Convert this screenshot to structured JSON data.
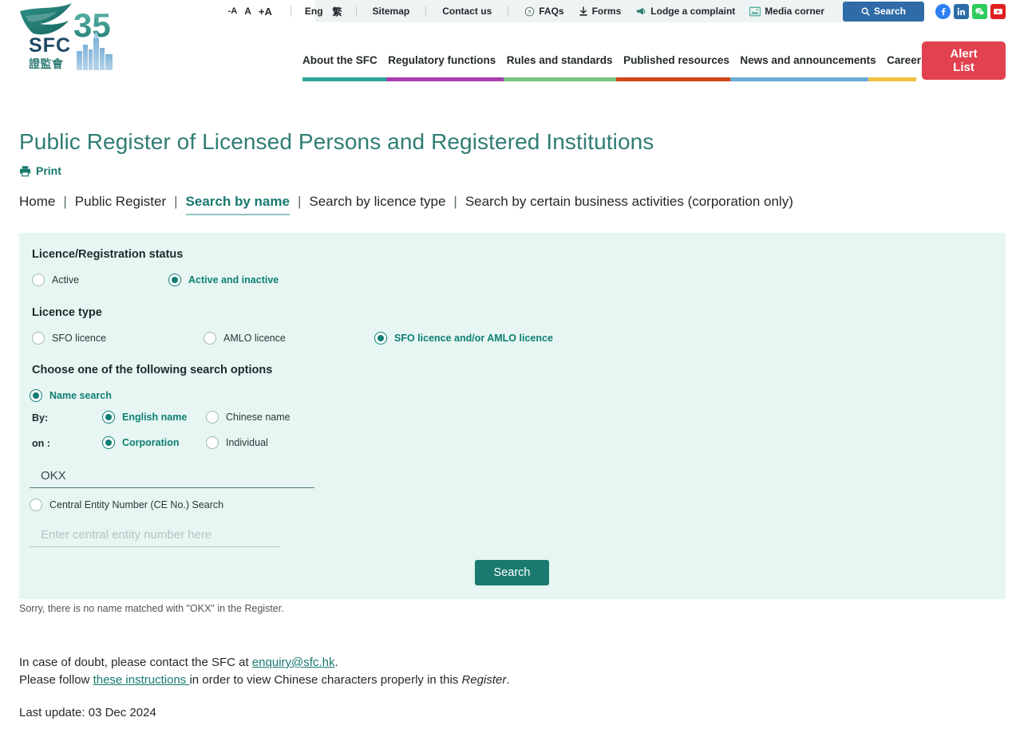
{
  "topbar": {
    "font_size": {
      "decrease": "-A",
      "normal": "A",
      "increase": "+A"
    },
    "lang_en": "Eng",
    "lang_zh": "繁",
    "sitemap": "Sitemap",
    "contact": "Contact us",
    "faqs": "FAQs",
    "forms": "Forms",
    "complaint": "Lodge a complaint",
    "media": "Media corner",
    "search_button": "Search",
    "socials": [
      {
        "name": "facebook-icon",
        "color": "#2d7ff2",
        "glyph": "f"
      },
      {
        "name": "linkedin-icon",
        "color": "#2f6ca7",
        "glyph": "in"
      },
      {
        "name": "wechat-icon",
        "color": "#2ecc5e",
        "glyph": "●"
      },
      {
        "name": "youtube-icon",
        "color": "#e02020",
        "glyph": "▶"
      }
    ]
  },
  "logo": {
    "acronym": "SFC",
    "chinese": "證監會",
    "anniversary": "35",
    "alt": "sfc-35-logo"
  },
  "nav": {
    "items": [
      {
        "label": "About the SFC",
        "color": "#2aa69a"
      },
      {
        "label": "Regulatory functions",
        "color": "#a93fae"
      },
      {
        "label": "Rules and standards",
        "color": "#7cc47f"
      },
      {
        "label": "Published resources",
        "color": "#cf4715"
      },
      {
        "label": "News and announcements",
        "color": "#6aabd4"
      },
      {
        "label": "Career",
        "color": "#f0c040"
      }
    ],
    "alert_list": "Alert\nList",
    "alert_list_line1": "Alert",
    "alert_list_line2": "List"
  },
  "page": {
    "title": "Public Register of Licensed Persons and Registered Institutions",
    "print": "Print"
  },
  "breadcrumb": {
    "items": [
      {
        "label": "Home",
        "active": false
      },
      {
        "label": "Public Register",
        "active": false
      },
      {
        "label": "Search by name",
        "active": true
      },
      {
        "label": "Search by licence type",
        "active": false
      },
      {
        "label": "Search by certain business activities (corporation only)",
        "active": false
      }
    ],
    "separator": "|"
  },
  "form": {
    "status_heading": "Licence/Registration status",
    "status_options": [
      {
        "label": "Active",
        "selected": false
      },
      {
        "label": "Active and inactive",
        "selected": true
      }
    ],
    "licence_type_heading": "Licence type",
    "licence_type_options": [
      {
        "label": "SFO licence",
        "selected": false
      },
      {
        "label": "AMLO licence",
        "selected": false
      },
      {
        "label": "SFO licence and/or AMLO licence",
        "selected": true
      }
    ],
    "search_options_heading": "Choose one of the following search options",
    "name_search": {
      "label": "Name search",
      "selected": true
    },
    "by_label": "By:",
    "by_options": [
      {
        "label": "English name",
        "selected": true
      },
      {
        "label": "Chinese name",
        "selected": false
      }
    ],
    "on_label": "on :",
    "on_options": [
      {
        "label": "Corporation",
        "selected": true
      },
      {
        "label": "Individual",
        "selected": false
      }
    ],
    "name_input_value": "OKX",
    "name_input_placeholder": "",
    "ce_search": {
      "label": "Central Entity Number (CE No.) Search",
      "selected": false
    },
    "ce_input_value": "",
    "ce_input_placeholder": "Enter central entity number here",
    "submit_label": "Search"
  },
  "result": {
    "message": "Sorry, there is no name matched with \"OKX\" in the Register."
  },
  "footer": {
    "line1_pre": "In case of doubt, please contact the SFC at ",
    "line1_link": "enquiry@sfc.hk",
    "line1_post": ".",
    "line2_pre": "Please follow ",
    "line2_link": "these instructions ",
    "line2_mid": "in order to view Chinese characters properly in this ",
    "line2_em": "Register",
    "line2_post": ".",
    "last_update": "Last update: 03 Dec 2024"
  },
  "colors": {
    "brand_teal": "#17796e",
    "title_teal": "#2f7d75",
    "panel_bg": "#e7f6f3",
    "alert_red": "#e2414f",
    "top_search_blue": "#2f6ca7"
  }
}
